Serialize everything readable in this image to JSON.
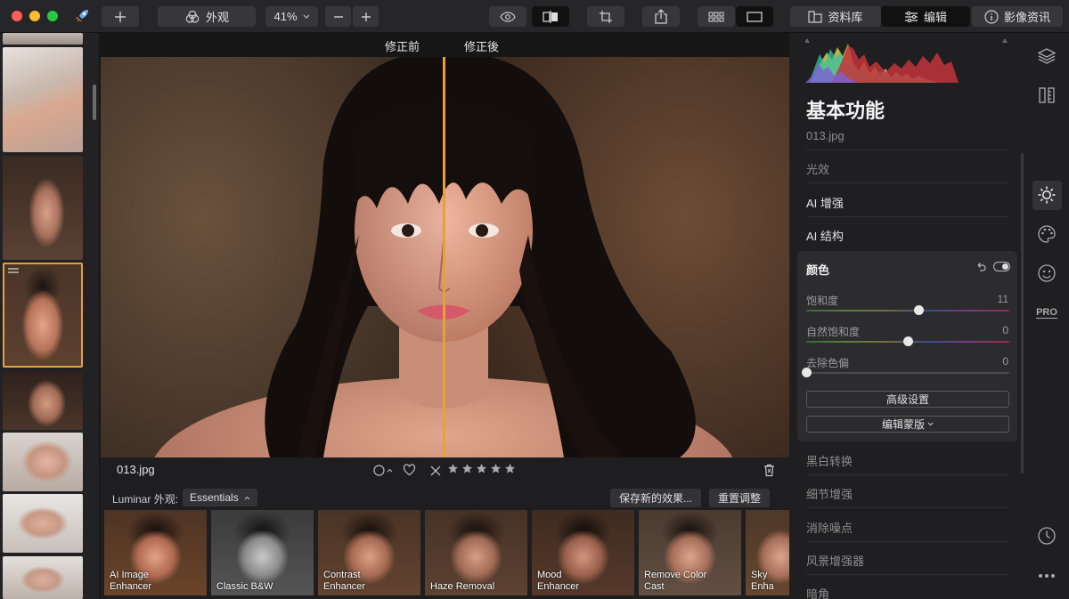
{
  "toolbar": {
    "looks_label": "外观",
    "zoom_label": "41%",
    "library_label": "资料库",
    "edit_label": "编辑",
    "info_label": "影像资讯"
  },
  "viewer": {
    "before_label": "修正前",
    "after_label": "修正後"
  },
  "infobar": {
    "filename": "013.jpg",
    "rating": 0
  },
  "looks": {
    "header_label": "Luminar 外观:",
    "category": "Essentials",
    "save_button": "保存新的效果...",
    "reset_button": "重置调整",
    "items": [
      {
        "label": "AI Image\nEnhancer"
      },
      {
        "label": "Classic B&W"
      },
      {
        "label": "Contrast\nEnhancer"
      },
      {
        "label": "Haze Removal"
      },
      {
        "label": "Mood\nEnhancer"
      },
      {
        "label": "Remove Color\nCast"
      },
      {
        "label": "Sky Enha"
      }
    ]
  },
  "panel": {
    "title": "基本功能",
    "filename": "013.jpg",
    "sections_top": [
      "光效",
      "AI 增强",
      "AI 结构"
    ],
    "color_card": {
      "title": "颜色",
      "saturation": {
        "label": "饱和度",
        "value": "11",
        "position": 0.555
      },
      "vibrance": {
        "label": "自然饱和度",
        "value": "0",
        "position": 0.5
      },
      "remove_cast": {
        "label": "去除色偏",
        "value": "0",
        "position": 0.0
      },
      "advanced_button": "高级设置",
      "mask_button": "编辑蒙版"
    },
    "sections_bottom": [
      "黑白转换",
      "细节增强",
      "消除噪点",
      "风景增强器",
      "暗角"
    ]
  },
  "rail": {
    "pro_label": "PRO"
  },
  "colors": {
    "accent": "#e6a13a",
    "panel_bg": "#1f1f21",
    "card_bg": "#2c2c2f"
  }
}
